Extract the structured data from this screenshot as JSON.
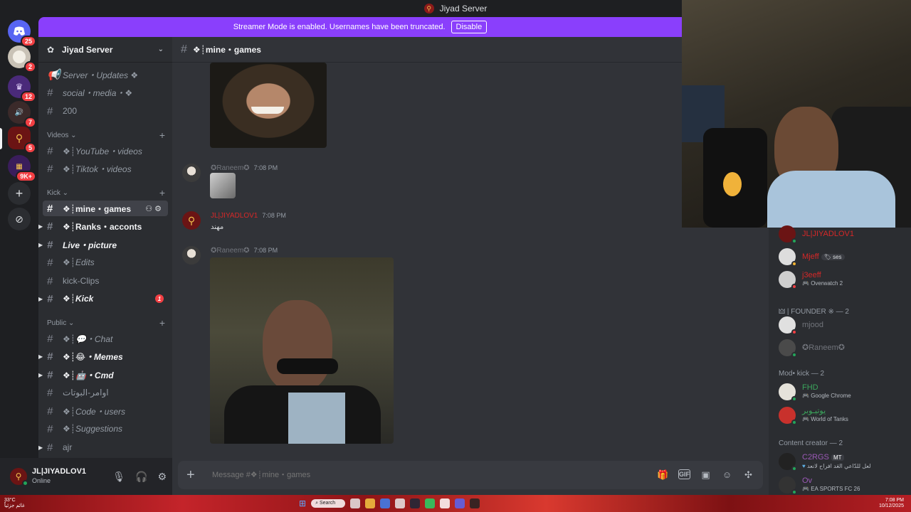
{
  "titlebar": {
    "title": "Jiyad Server"
  },
  "banner": {
    "text": "Streamer Mode is enabled. Usernames have been truncated.",
    "button": "Disable"
  },
  "rail": {
    "badges": [
      "25",
      "2",
      "12",
      "7",
      "5",
      "9K+"
    ]
  },
  "guild": {
    "name": "Jiyad Server"
  },
  "channels": [
    {
      "label": "Server・Updates ❖",
      "style": "italic"
    },
    {
      "label": "social・media・❖",
      "style": "italic"
    },
    {
      "label": "200",
      "style": "normal"
    }
  ],
  "categories": {
    "videos": "Videos",
    "kick": "Kick",
    "public": "Public"
  },
  "videos_channels": [
    {
      "label": "❖┊YouTube・videos"
    },
    {
      "label": "❖┊Tiktok・videos"
    }
  ],
  "kick_channels": [
    {
      "label": "❖┊mine・games"
    },
    {
      "label": "❖┊Ranks・acconts"
    },
    {
      "label": "Live・picture"
    },
    {
      "label": "❖┊Edits"
    },
    {
      "label": "kick-Clips"
    },
    {
      "label": "❖┊Kick",
      "unread": "1"
    }
  ],
  "public_channels": [
    {
      "label": "❖┊💬・Chat"
    },
    {
      "label": "❖┊😂・Memes"
    },
    {
      "label": "❖┊🤖・Cmd"
    },
    {
      "label": "اوامر-البوتات"
    },
    {
      "label": "❖┊Code・users"
    },
    {
      "label": "❖┊Suggestions"
    },
    {
      "label": "ajr"
    }
  ],
  "user": {
    "name": "JL|JIYADLOV1",
    "status": "Online"
  },
  "chat": {
    "channel": "❖┊mine・games",
    "placeholder": "Message #❖┊mine・games",
    "messages": [
      {
        "author": "✪Raneem✪",
        "time": "7:08 PM"
      },
      {
        "author": "JL|JIYADLOV1",
        "time": "7:08 PM",
        "text": "مهند"
      },
      {
        "author": "✪Raneem✪",
        "time": "7:08 PM"
      }
    ]
  },
  "members": {
    "top": [
      {
        "name": "JL|JIYADLOV1",
        "color": "#d62828"
      },
      {
        "name": "Mjeff",
        "color": "#d62828",
        "activity": "ses"
      },
      {
        "name": "j3eeff",
        "color": "#d62828",
        "activity": "Overwatch 2"
      }
    ],
    "founder_group": "🜲 | FOUNDER ※ — 2",
    "founder": [
      {
        "name": "mjood",
        "color": "#71747b"
      },
      {
        "name": "✪Raneem✪",
        "color": "#71747b"
      }
    ],
    "mod_group": "Mod• kick — 2",
    "mod": [
      {
        "name": "FHD",
        "color": "#3ba55c",
        "activity": "Google Chrome"
      },
      {
        "name": "يوتيـوبر",
        "color": "#3ba55c",
        "activity": "World of Tanks"
      }
    ],
    "creator_group": "Content creator — 2",
    "creator": [
      {
        "name": "C2RGS",
        "color": "#9b59b6",
        "tag": "MT",
        "activity": "لعل للدّاعي العَد افراح لانعد"
      },
      {
        "name": "Ov",
        "color": "#9b59b6",
        "activity": "EA SPORTS FC 26"
      }
    ]
  },
  "taskbar": {
    "temp": "33°C",
    "weather": "غائم جزئياً",
    "search": "Search",
    "time": "7:08 PM",
    "date": "10/12/2025"
  },
  "colors": {
    "accent": "#8a3ffc",
    "danger": "#f23f43",
    "online": "#23a55a"
  }
}
